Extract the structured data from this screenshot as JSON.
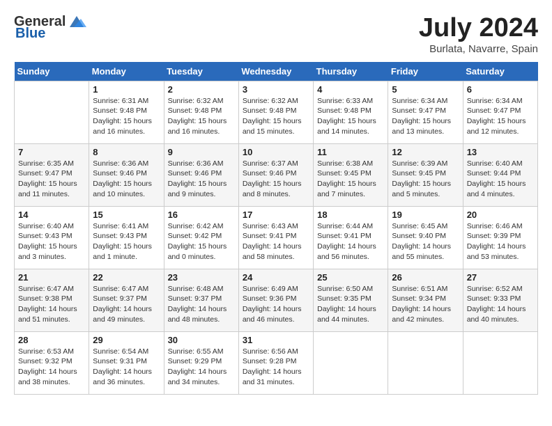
{
  "header": {
    "logo_general": "General",
    "logo_blue": "Blue",
    "month_title": "July 2024",
    "location": "Burlata, Navarre, Spain"
  },
  "weekdays": [
    "Sunday",
    "Monday",
    "Tuesday",
    "Wednesday",
    "Thursday",
    "Friday",
    "Saturday"
  ],
  "rows": [
    [
      {
        "day": "",
        "sunrise": "",
        "sunset": "",
        "daylight": ""
      },
      {
        "day": "1",
        "sunrise": "Sunrise: 6:31 AM",
        "sunset": "Sunset: 9:48 PM",
        "daylight": "Daylight: 15 hours and 16 minutes."
      },
      {
        "day": "2",
        "sunrise": "Sunrise: 6:32 AM",
        "sunset": "Sunset: 9:48 PM",
        "daylight": "Daylight: 15 hours and 16 minutes."
      },
      {
        "day": "3",
        "sunrise": "Sunrise: 6:32 AM",
        "sunset": "Sunset: 9:48 PM",
        "daylight": "Daylight: 15 hours and 15 minutes."
      },
      {
        "day": "4",
        "sunrise": "Sunrise: 6:33 AM",
        "sunset": "Sunset: 9:48 PM",
        "daylight": "Daylight: 15 hours and 14 minutes."
      },
      {
        "day": "5",
        "sunrise": "Sunrise: 6:34 AM",
        "sunset": "Sunset: 9:47 PM",
        "daylight": "Daylight: 15 hours and 13 minutes."
      },
      {
        "day": "6",
        "sunrise": "Sunrise: 6:34 AM",
        "sunset": "Sunset: 9:47 PM",
        "daylight": "Daylight: 15 hours and 12 minutes."
      }
    ],
    [
      {
        "day": "7",
        "sunrise": "Sunrise: 6:35 AM",
        "sunset": "Sunset: 9:47 PM",
        "daylight": "Daylight: 15 hours and 11 minutes."
      },
      {
        "day": "8",
        "sunrise": "Sunrise: 6:36 AM",
        "sunset": "Sunset: 9:46 PM",
        "daylight": "Daylight: 15 hours and 10 minutes."
      },
      {
        "day": "9",
        "sunrise": "Sunrise: 6:36 AM",
        "sunset": "Sunset: 9:46 PM",
        "daylight": "Daylight: 15 hours and 9 minutes."
      },
      {
        "day": "10",
        "sunrise": "Sunrise: 6:37 AM",
        "sunset": "Sunset: 9:46 PM",
        "daylight": "Daylight: 15 hours and 8 minutes."
      },
      {
        "day": "11",
        "sunrise": "Sunrise: 6:38 AM",
        "sunset": "Sunset: 9:45 PM",
        "daylight": "Daylight: 15 hours and 7 minutes."
      },
      {
        "day": "12",
        "sunrise": "Sunrise: 6:39 AM",
        "sunset": "Sunset: 9:45 PM",
        "daylight": "Daylight: 15 hours and 5 minutes."
      },
      {
        "day": "13",
        "sunrise": "Sunrise: 6:40 AM",
        "sunset": "Sunset: 9:44 PM",
        "daylight": "Daylight: 15 hours and 4 minutes."
      }
    ],
    [
      {
        "day": "14",
        "sunrise": "Sunrise: 6:40 AM",
        "sunset": "Sunset: 9:43 PM",
        "daylight": "Daylight: 15 hours and 3 minutes."
      },
      {
        "day": "15",
        "sunrise": "Sunrise: 6:41 AM",
        "sunset": "Sunset: 9:43 PM",
        "daylight": "Daylight: 15 hours and 1 minute."
      },
      {
        "day": "16",
        "sunrise": "Sunrise: 6:42 AM",
        "sunset": "Sunset: 9:42 PM",
        "daylight": "Daylight: 15 hours and 0 minutes."
      },
      {
        "day": "17",
        "sunrise": "Sunrise: 6:43 AM",
        "sunset": "Sunset: 9:41 PM",
        "daylight": "Daylight: 14 hours and 58 minutes."
      },
      {
        "day": "18",
        "sunrise": "Sunrise: 6:44 AM",
        "sunset": "Sunset: 9:41 PM",
        "daylight": "Daylight: 14 hours and 56 minutes."
      },
      {
        "day": "19",
        "sunrise": "Sunrise: 6:45 AM",
        "sunset": "Sunset: 9:40 PM",
        "daylight": "Daylight: 14 hours and 55 minutes."
      },
      {
        "day": "20",
        "sunrise": "Sunrise: 6:46 AM",
        "sunset": "Sunset: 9:39 PM",
        "daylight": "Daylight: 14 hours and 53 minutes."
      }
    ],
    [
      {
        "day": "21",
        "sunrise": "Sunrise: 6:47 AM",
        "sunset": "Sunset: 9:38 PM",
        "daylight": "Daylight: 14 hours and 51 minutes."
      },
      {
        "day": "22",
        "sunrise": "Sunrise: 6:47 AM",
        "sunset": "Sunset: 9:37 PM",
        "daylight": "Daylight: 14 hours and 49 minutes."
      },
      {
        "day": "23",
        "sunrise": "Sunrise: 6:48 AM",
        "sunset": "Sunset: 9:37 PM",
        "daylight": "Daylight: 14 hours and 48 minutes."
      },
      {
        "day": "24",
        "sunrise": "Sunrise: 6:49 AM",
        "sunset": "Sunset: 9:36 PM",
        "daylight": "Daylight: 14 hours and 46 minutes."
      },
      {
        "day": "25",
        "sunrise": "Sunrise: 6:50 AM",
        "sunset": "Sunset: 9:35 PM",
        "daylight": "Daylight: 14 hours and 44 minutes."
      },
      {
        "day": "26",
        "sunrise": "Sunrise: 6:51 AM",
        "sunset": "Sunset: 9:34 PM",
        "daylight": "Daylight: 14 hours and 42 minutes."
      },
      {
        "day": "27",
        "sunrise": "Sunrise: 6:52 AM",
        "sunset": "Sunset: 9:33 PM",
        "daylight": "Daylight: 14 hours and 40 minutes."
      }
    ],
    [
      {
        "day": "28",
        "sunrise": "Sunrise: 6:53 AM",
        "sunset": "Sunset: 9:32 PM",
        "daylight": "Daylight: 14 hours and 38 minutes."
      },
      {
        "day": "29",
        "sunrise": "Sunrise: 6:54 AM",
        "sunset": "Sunset: 9:31 PM",
        "daylight": "Daylight: 14 hours and 36 minutes."
      },
      {
        "day": "30",
        "sunrise": "Sunrise: 6:55 AM",
        "sunset": "Sunset: 9:29 PM",
        "daylight": "Daylight: 14 hours and 34 minutes."
      },
      {
        "day": "31",
        "sunrise": "Sunrise: 6:56 AM",
        "sunset": "Sunset: 9:28 PM",
        "daylight": "Daylight: 14 hours and 31 minutes."
      },
      {
        "day": "",
        "sunrise": "",
        "sunset": "",
        "daylight": ""
      },
      {
        "day": "",
        "sunrise": "",
        "sunset": "",
        "daylight": ""
      },
      {
        "day": "",
        "sunrise": "",
        "sunset": "",
        "daylight": ""
      }
    ]
  ]
}
